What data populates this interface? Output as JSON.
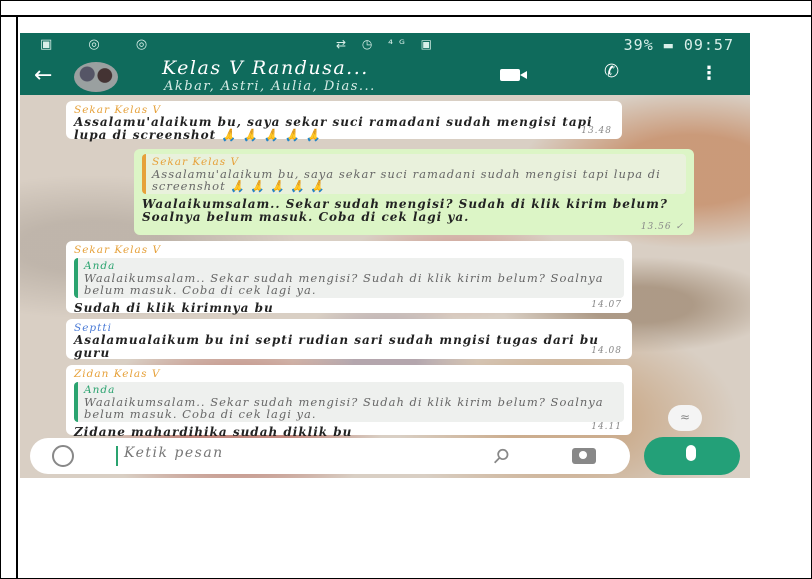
{
  "status": {
    "left_icons": "▣ ◎ ◎",
    "middle_icons": "⇄ ◷ ⁴ᴳ ▣",
    "signal": "39%",
    "time": "09:57"
  },
  "header": {
    "title": "Kelas V Randusa...",
    "subtitle": "Akbar, Astri, Aulia, Dias..."
  },
  "messages": [
    {
      "sender": "Sekar Kelas V",
      "text": "Assalamu'alaikum bu, saya sekar suci ramadani sudah mengisi tapi lupa di screenshot 🙏 🙏 🙏 🙏 🙏",
      "time": "13.48"
    },
    {
      "quote_name": "Sekar Kelas V",
      "quote_text": "Assalamu'alaikum bu, saya sekar suci ramadani sudah mengisi tapi lupa di screenshot 🙏 🙏 🙏 🙏 🙏",
      "text": "Waalaikumsalam.. Sekar sudah mengisi? Sudah di klik kirim belum? Soalnya belum masuk. Coba di cek lagi ya.",
      "time": "13.56 ✓"
    },
    {
      "sender": "Sekar Kelas V",
      "quote_name": "Anda",
      "quote_text": "Waalaikumsalam.. Sekar sudah mengisi? Sudah di klik kirim belum? Soalnya belum masuk. Coba di cek lagi ya.",
      "text": "Sudah di klik kirimnya bu",
      "time": "14.07"
    },
    {
      "sender": "Septti",
      "text": "Asalamualaikum bu ini septi rudian sari sudah mngisi tugas dari bu guru",
      "time": "14.08"
    },
    {
      "sender": "Zidan Kelas V",
      "quote_name": "Anda",
      "quote_text": "Waalaikumsalam.. Sekar sudah mengisi? Sudah di klik kirim belum? Soalnya belum masuk. Coba di cek lagi ya.",
      "text": "Zidane mahardihika sudah diklik bu",
      "time": "14.11"
    }
  ],
  "input": {
    "placeholder": "Ketik pesan"
  },
  "scroll_down": "≈",
  "icons": [
    "back-arrow-icon",
    "video-call-icon",
    "phone-icon",
    "more-icon",
    "emoji-icon",
    "attach-icon",
    "camera-icon",
    "mic-icon"
  ]
}
